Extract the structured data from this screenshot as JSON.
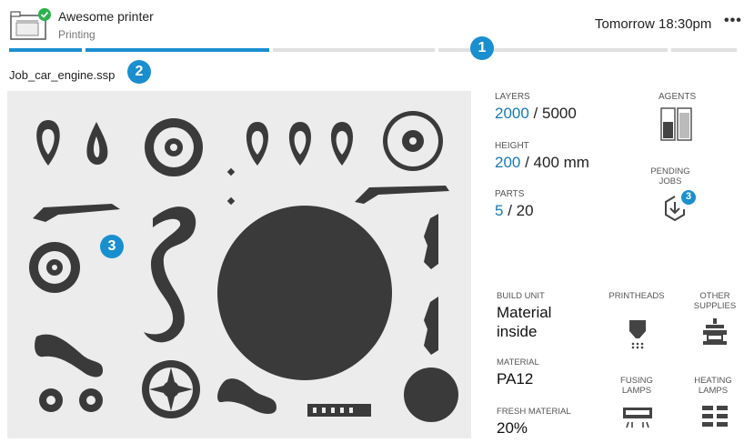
{
  "header": {
    "printer_name": "Awesome printer",
    "status": "Printing",
    "eta": "Tomorrow 18:30pm",
    "more_label": "•••"
  },
  "progress": {
    "fraction": 0.4
  },
  "job": {
    "filename": "Job_car_engine.ssp"
  },
  "callouts": {
    "c1": "1",
    "c2": "2",
    "c3": "3"
  },
  "stats": {
    "layers_label": "LAYERS",
    "layers_current": "2000",
    "layers_total": " / 5000",
    "height_label": "HEIGHT",
    "height_current": "200",
    "height_total": " / 400 mm",
    "parts_label": "PARTS",
    "parts_current": "5",
    "parts_total": " / 20",
    "agents_label": "AGENTS",
    "pending_label_1": "PENDING",
    "pending_label_2": "JOBS",
    "pending_count": "3"
  },
  "supplies": {
    "build_unit_label": "BUILD UNIT",
    "build_unit_value_1": "Material",
    "build_unit_value_2": "inside",
    "material_label": "MATERIAL",
    "material_value": "PA12",
    "fresh_label": "FRESH MATERIAL",
    "fresh_value": "20%",
    "printheads_label": "PRINTHEADS",
    "other_label_1": "OTHER",
    "other_label_2": "SUPPLIES",
    "fusing_label_1": "FUSING",
    "fusing_label_2": "LAMPS",
    "heating_label_1": "HEATING",
    "heating_label_2": "LAMPS"
  },
  "colors": {
    "accent": "#1a8fd0",
    "value_blue": "#1679b8",
    "status_green": "#2bb24c",
    "part_dark": "#3a3a3a"
  }
}
